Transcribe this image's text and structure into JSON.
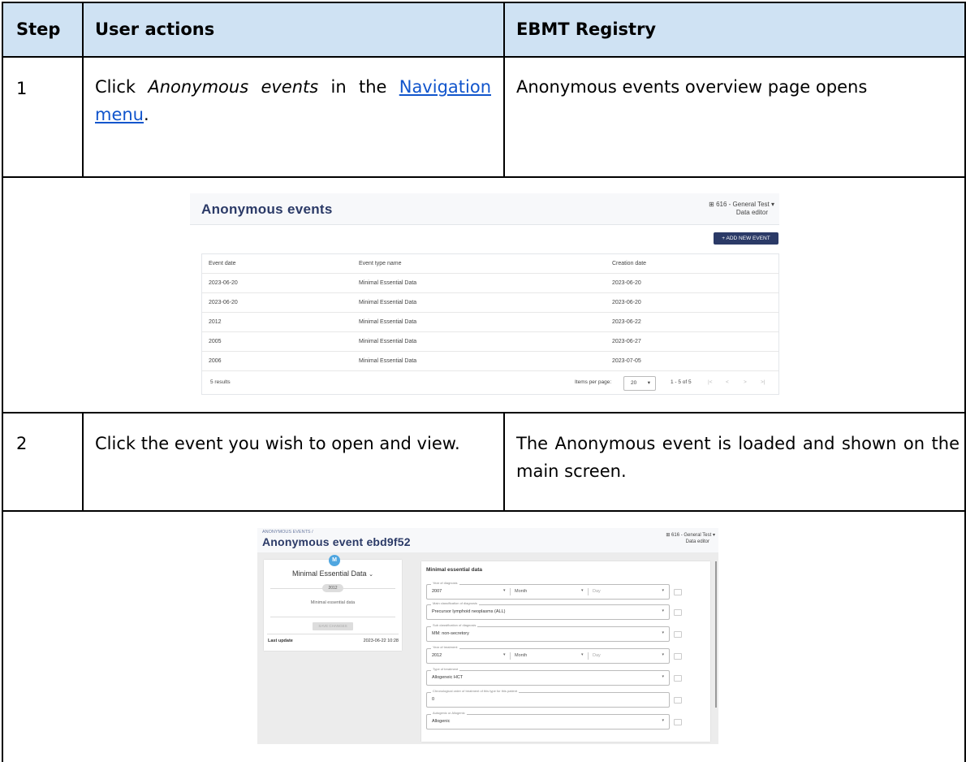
{
  "table": {
    "headers": {
      "step": "Step",
      "user_actions": "User actions",
      "registry": "EBMT Registry"
    },
    "row1": {
      "step": "1",
      "action_prefix": "Click ",
      "action_italic": "Anonymous events",
      "action_mid": " in the ",
      "action_link": "Navigation menu",
      "action_suffix": ".",
      "result": "Anonymous events overview page opens"
    },
    "row2": {
      "step": "2",
      "action": "Click the event you wish to open and view.",
      "result": "The Anonymous event is loaded and shown on the main screen."
    }
  },
  "screenshot1": {
    "title": "Anonymous events",
    "tenant": "616 - General Test",
    "role": "Data editor",
    "add_button": "+ ADD NEW EVENT",
    "columns": [
      "Event date",
      "Event type name",
      "Creation date"
    ],
    "rows": [
      [
        "2023-06-20",
        "Minimal Essential Data",
        "2023-06-20"
      ],
      [
        "2023-06-20",
        "Minimal Essential Data",
        "2023-06-20"
      ],
      [
        "2012",
        "Minimal Essential Data",
        "2023-06-22"
      ],
      [
        "2005",
        "Minimal Essential Data",
        "2023-06-27"
      ],
      [
        "2006",
        "Minimal Essential Data",
        "2023-07-05"
      ]
    ],
    "results": "5 results",
    "items_per_page_label": "Items per page:",
    "items_per_page": "20",
    "range": "1 - 5 of 5"
  },
  "screenshot2": {
    "breadcrumb": "ANONYMOUS EVENTS /",
    "title": "Anonymous event ebd9f52",
    "tenant": "616 - General Test",
    "role": "Data editor",
    "avatar": "M",
    "event_type": "Minimal Essential Data",
    "year_chip": "2012",
    "subtitle": "Minimal essential data",
    "save_button": "SAVE CHANGES",
    "last_update_label": "Last update",
    "last_update_value": "2023-06-22 10:28",
    "form_title": "Minimal essential data",
    "fields": {
      "year_diag": {
        "label": "Year of diagnosis",
        "value": "2007",
        "month": "Month",
        "day": "Day"
      },
      "main_class": {
        "label": "Main classification of diagnosis",
        "value": "Precursor lymphoid neoplasms (ALL)"
      },
      "sub_class": {
        "label": "Sub classification of diagnosis",
        "value": "MM: non-secretory"
      },
      "year_treat": {
        "label": "Year of treatment",
        "value": "2012",
        "month": "Month",
        "day": "Day"
      },
      "type_treat": {
        "label": "Type of treatment",
        "value": "Allogeneic HCT"
      },
      "chrono": {
        "label": "Chronological order of treatment of this type for this patient",
        "value": "0"
      },
      "auto_allo": {
        "label": "Autogenic or Allogenic",
        "value": "Allogenic"
      }
    }
  }
}
